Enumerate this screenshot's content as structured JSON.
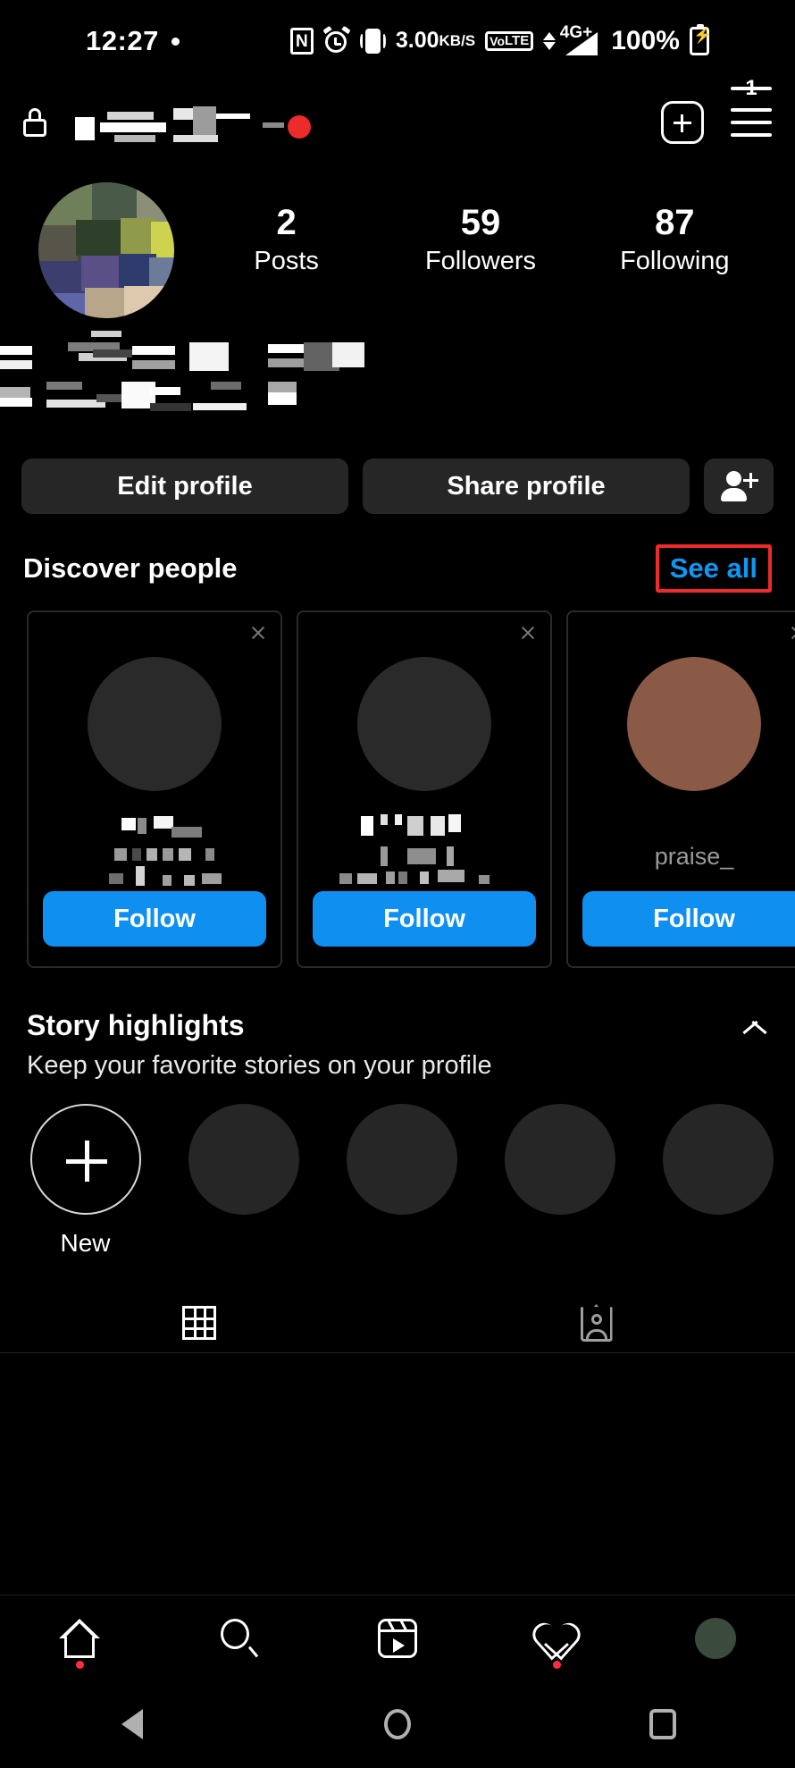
{
  "status_bar": {
    "time": "12:27",
    "data_speed_value": "3.00",
    "data_speed_unit": "KB/S",
    "nfc_label": "N",
    "volte_top": "Vo",
    "volte_bottom": "LTE",
    "network": "4G+",
    "battery_percent": "100%",
    "icons": [
      "nfc-icon",
      "alarm-icon",
      "vibrate-icon",
      "data-speed-icon",
      "volte-icon",
      "signal-icon",
      "battery-charging-icon"
    ]
  },
  "app_bar": {
    "lock_icon": "lock-icon",
    "username": "",
    "username_redacted": true,
    "add_button_icon": "plus-square-icon",
    "menu_button_icon": "hamburger-menu-icon",
    "menu_badge_count": "1"
  },
  "profile": {
    "avatar_alt": "profile-avatar",
    "stats": [
      {
        "num": "2",
        "label": "Posts"
      },
      {
        "num": "59",
        "label": "Followers"
      },
      {
        "num": "87",
        "label": "Following"
      }
    ],
    "bio_redacted": true,
    "buttons": {
      "edit_profile": "Edit profile",
      "share_profile": "Share profile",
      "add_user_icon": "add-person-icon"
    }
  },
  "discover": {
    "title": "Discover people",
    "see_all": "See all",
    "see_all_highlighted": true,
    "highlight_color": "#EE2B2B",
    "accent_color": "#0F97F2",
    "cards": [
      {
        "name": "",
        "redacted": true,
        "follow_label": "Follow"
      },
      {
        "name": "",
        "redacted": true,
        "follow_label": "Follow"
      },
      {
        "name": "praise_",
        "redacted": false,
        "follow_label": "Follow"
      }
    ]
  },
  "story_highlights": {
    "title": "Story highlights",
    "subtitle": "Keep your favorite stories on your profile",
    "collapse_icon": "chevron-up-icon",
    "new_label": "New",
    "placeholder_count": 4
  },
  "profile_tabs": [
    {
      "name": "grid-tab",
      "icon": "grid-icon",
      "active": true
    },
    {
      "name": "tagged-tab",
      "icon": "tagged-person-icon",
      "active": false
    }
  ],
  "bottom_nav": [
    {
      "name": "home",
      "icon": "home-icon",
      "dot": true
    },
    {
      "name": "search",
      "icon": "search-icon",
      "dot": false
    },
    {
      "name": "reels",
      "icon": "reels-icon",
      "dot": false
    },
    {
      "name": "activity",
      "icon": "heart-icon",
      "dot": true
    },
    {
      "name": "profile",
      "icon": "profile-avatar-icon",
      "dot": false
    }
  ],
  "android_nav": [
    {
      "name": "back",
      "icon": "back-triangle-icon"
    },
    {
      "name": "home",
      "icon": "home-circle-icon"
    },
    {
      "name": "recents",
      "icon": "recents-square-icon"
    }
  ]
}
